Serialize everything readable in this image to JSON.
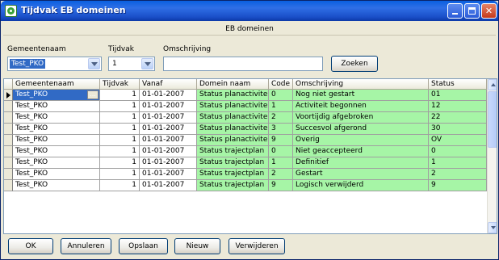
{
  "window": {
    "title": "Tijdvak EB domeinen",
    "caption": "EB domeinen",
    "min_glyph": "",
    "close_glyph": "✕"
  },
  "filters": {
    "gemeente_label": "Gemeentenaam",
    "gemeente_value": "Test_PKO",
    "tijdvak_label": "Tijdvak",
    "tijdvak_value": "1",
    "omschrijving_label": "Omschrijving",
    "omschrijving_value": "",
    "search_label": "Zoeken"
  },
  "grid": {
    "columns": [
      "Gemeentenaam",
      "Tijdvak",
      "Vanaf",
      "Domein naam",
      "Code",
      "Omschrijving",
      "Status"
    ],
    "ellipsis": "...",
    "rows": [
      {
        "gemeentenaam": "Test_PKO",
        "tijdvak": "1",
        "vanaf": "01-01-2007",
        "domein": "Status planactiviteit",
        "code": "0",
        "omschrijving": "Nog niet gestart",
        "status": "01"
      },
      {
        "gemeentenaam": "Test_PKO",
        "tijdvak": "1",
        "vanaf": "01-01-2007",
        "domein": "Status planactiviteit",
        "code": "1",
        "omschrijving": "Activiteit begonnen",
        "status": "12"
      },
      {
        "gemeentenaam": "Test_PKO",
        "tijdvak": "1",
        "vanaf": "01-01-2007",
        "domein": "Status planactiviteit",
        "code": "2",
        "omschrijving": "Voortijdig afgebroken",
        "status": "22"
      },
      {
        "gemeentenaam": "Test_PKO",
        "tijdvak": "1",
        "vanaf": "01-01-2007",
        "domein": "Status planactiviteit",
        "code": "3",
        "omschrijving": "Succesvol afgerond",
        "status": "30"
      },
      {
        "gemeentenaam": "Test_PKO",
        "tijdvak": "1",
        "vanaf": "01-01-2007",
        "domein": "Status planactiviteit",
        "code": "9",
        "omschrijving": "Overig",
        "status": "OV"
      },
      {
        "gemeentenaam": "Test_PKO",
        "tijdvak": "1",
        "vanaf": "01-01-2007",
        "domein": "Status trajectplan",
        "code": "0",
        "omschrijving": "Niet geaccepteerd",
        "status": "0"
      },
      {
        "gemeentenaam": "Test_PKO",
        "tijdvak": "1",
        "vanaf": "01-01-2007",
        "domein": "Status trajectplan",
        "code": "1",
        "omschrijving": "Definitief",
        "status": "1"
      },
      {
        "gemeentenaam": "Test_PKO",
        "tijdvak": "1",
        "vanaf": "01-01-2007",
        "domein": "Status trajectplan",
        "code": "2",
        "omschrijving": "Gestart",
        "status": "2"
      },
      {
        "gemeentenaam": "Test_PKO",
        "tijdvak": "1",
        "vanaf": "01-01-2007",
        "domein": "Status trajectplan",
        "code": "9",
        "omschrijving": "Logisch verwijderd",
        "status": "9"
      }
    ]
  },
  "footer": {
    "ok": "OK",
    "annuleren": "Annuleren",
    "opslaan": "Opslaan",
    "nieuw": "Nieuw",
    "verwijderen": "Verwijderen"
  },
  "colors": {
    "row_green": "#a6f5a6",
    "selection_blue": "#316ac5",
    "titlebar_blue": "#2f6fe6"
  }
}
